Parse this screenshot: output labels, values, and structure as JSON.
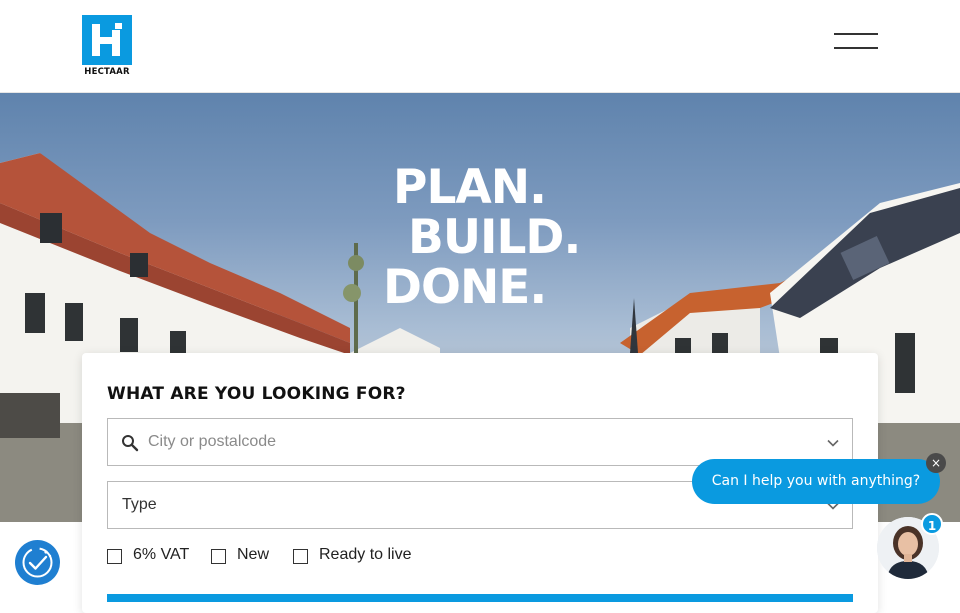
{
  "header": {
    "logo_text": "HECTAAR",
    "menu_icon": "hamburger-icon"
  },
  "hero": {
    "headline": [
      "PLAN.",
      "BUILD.",
      "DONE."
    ]
  },
  "search": {
    "title": "WHAT ARE YOU LOOKING FOR?",
    "city_placeholder": "City or postalcode",
    "type_label": "Type",
    "filters": [
      "6% VAT",
      "New",
      "Ready to live"
    ]
  },
  "chat": {
    "message": "Can I help you with anything?",
    "close_glyph": "×",
    "unread_count": "1"
  },
  "colors": {
    "accent": "#0a9ae0",
    "cookie": "#1f7fd1"
  }
}
